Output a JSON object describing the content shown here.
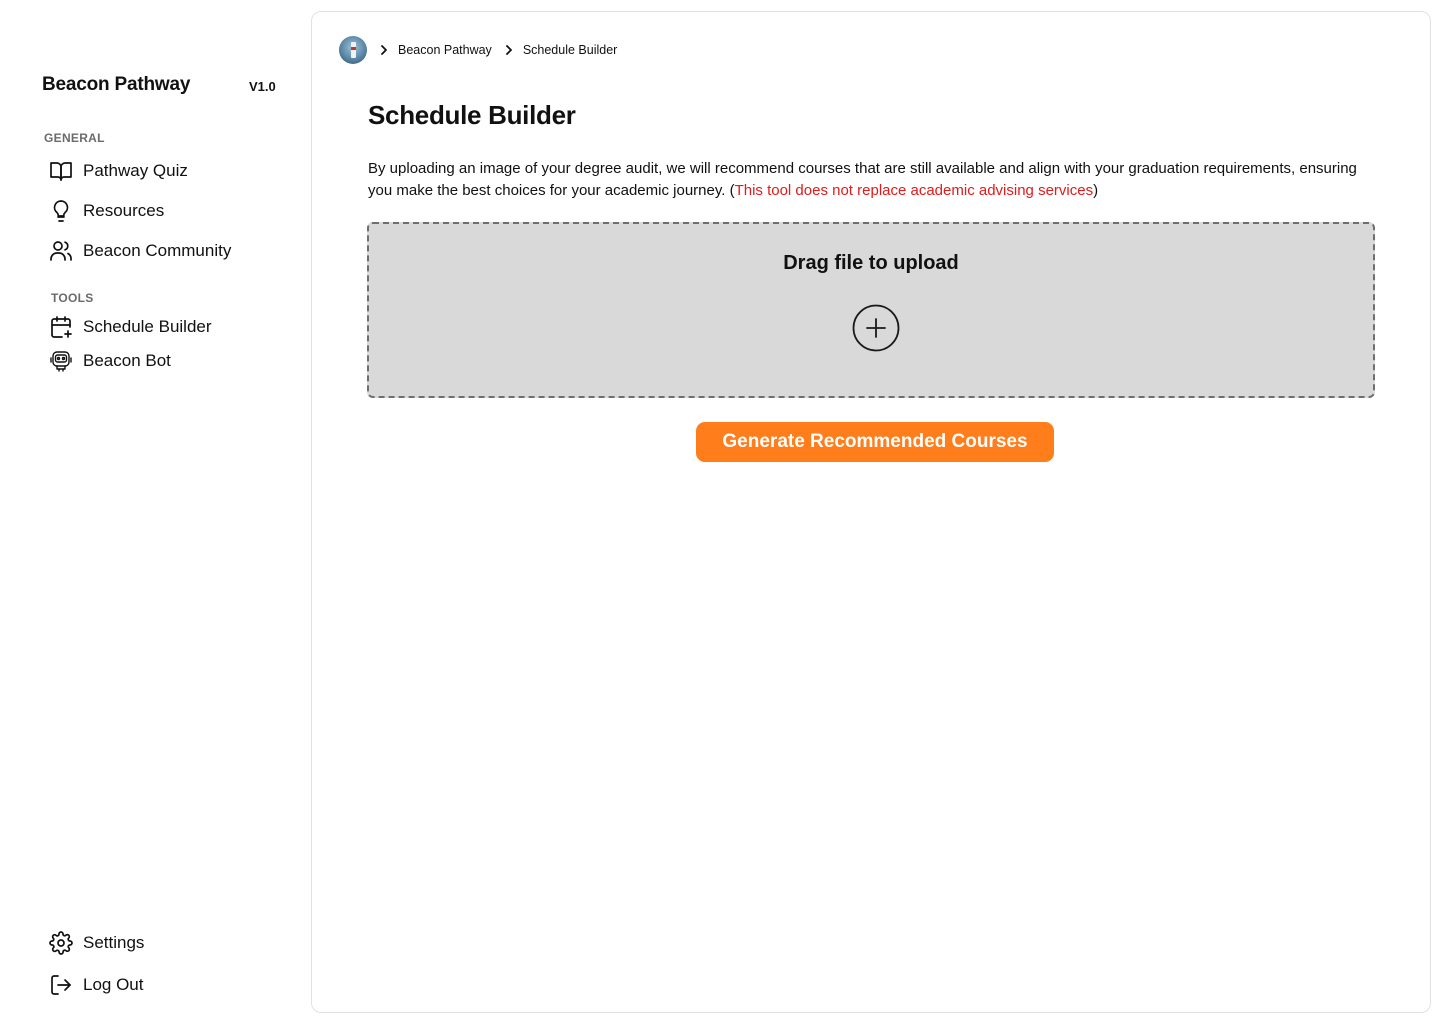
{
  "sidebar": {
    "brand": "Beacon Pathway",
    "version": "V1.0",
    "general_label": "GENERAL",
    "tools_label": "TOOLS",
    "general_items": [
      {
        "label": "Pathway Quiz",
        "icon": "book-icon"
      },
      {
        "label": "Resources",
        "icon": "lightbulb-icon"
      },
      {
        "label": "Beacon Community",
        "icon": "users-icon"
      }
    ],
    "tool_items": [
      {
        "label": "Schedule Builder",
        "icon": "calendar-plus-icon"
      },
      {
        "label": "Beacon Bot",
        "icon": "robot-icon"
      }
    ],
    "footer_items": [
      {
        "label": "Settings",
        "icon": "gear-icon"
      },
      {
        "label": "Log Out",
        "icon": "logout-icon"
      }
    ]
  },
  "breadcrumb": {
    "items": [
      "Beacon Pathway",
      "Schedule Builder"
    ]
  },
  "main": {
    "title": "Schedule Builder",
    "description": "By uploading an image of your degree audit, we will recommend courses that are still available and align with your graduation requirements, ensuring you make the best choices for your academic journey. (",
    "disclaimer": "This tool does not replace academic advising services",
    "description_end": ")",
    "dropzone_title": "Drag file to upload",
    "generate_label": "Generate Recommended Courses"
  },
  "colors": {
    "accent": "#ff7d1a",
    "warning": "#e01b1b",
    "dropzone_bg": "#d9d9d9"
  }
}
